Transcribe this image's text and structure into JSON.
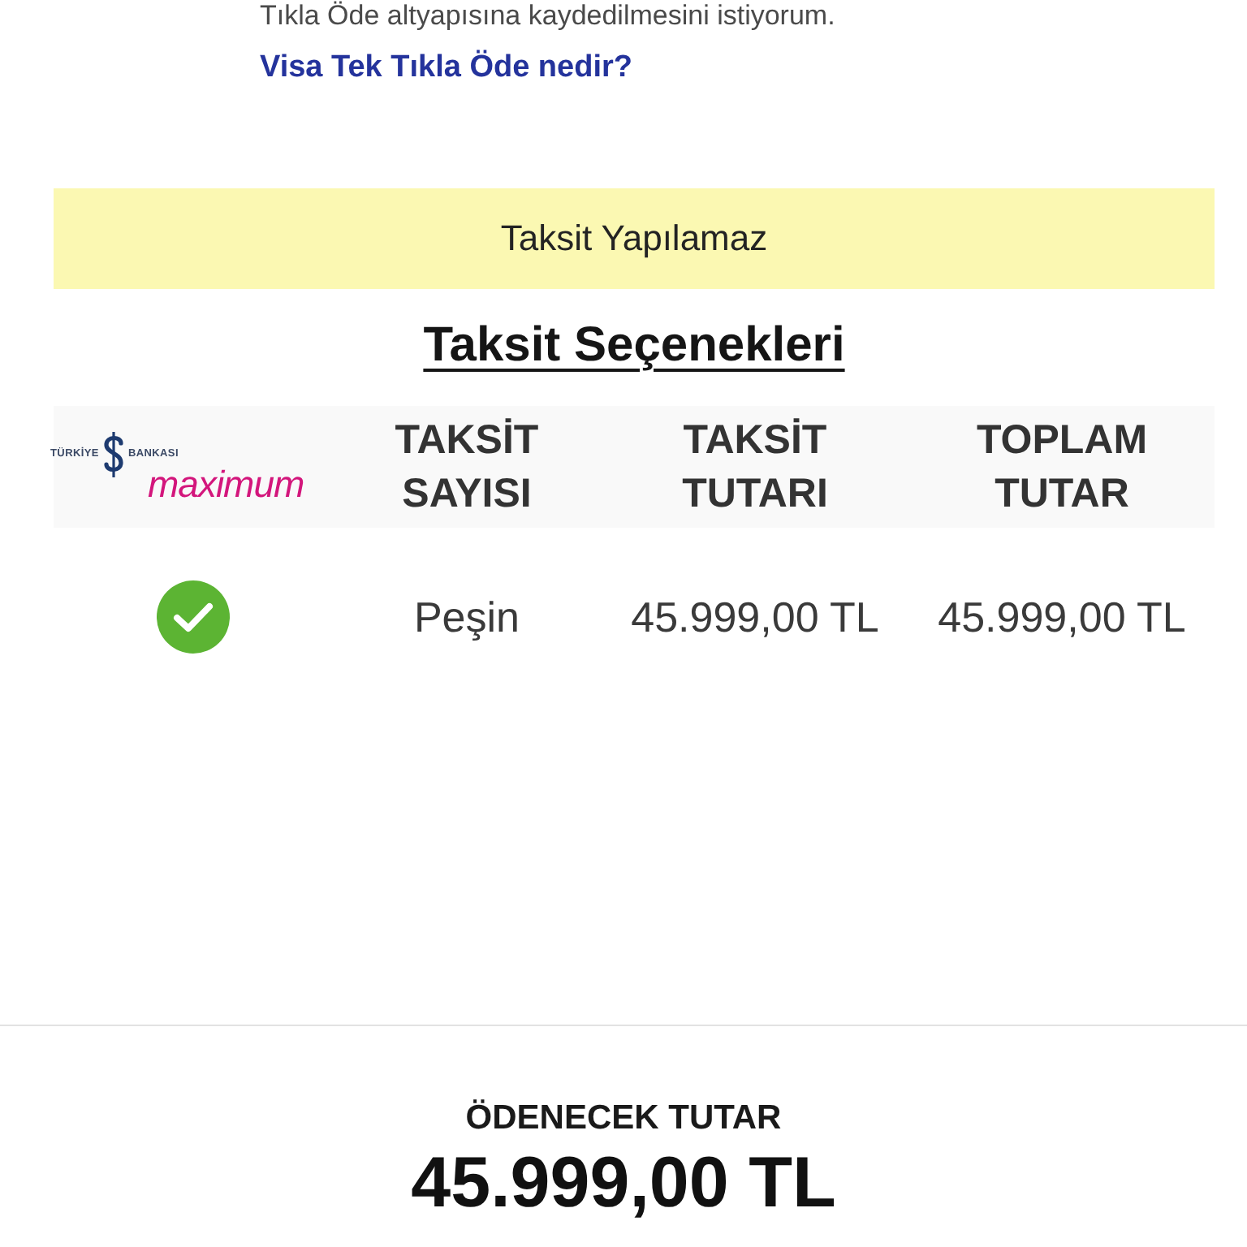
{
  "consent": {
    "text": "Tıkla Öde altyapısına kaydedilmesini istiyorum.",
    "link": "Visa Tek Tıkla Öde nedir?"
  },
  "notice": "Taksit Yapılamaz",
  "installments": {
    "title": "Taksit Seçenekleri",
    "bank_logo": {
      "bank_name_left": "TÜRKİYE",
      "bank_name_right": "BANKASI",
      "brand": "maximum"
    },
    "columns": [
      "TAKSİT SAYISI",
      "TAKSİT TUTARI",
      "TOPLAM TUTAR"
    ],
    "rows": [
      {
        "selected": true,
        "count": "Peşin",
        "installment_amount": "45.999,00 TL",
        "total_amount": "45.999,00 TL"
      }
    ]
  },
  "total": {
    "label": "ÖDENECEK TUTAR",
    "amount": "45.999,00 TL"
  }
}
